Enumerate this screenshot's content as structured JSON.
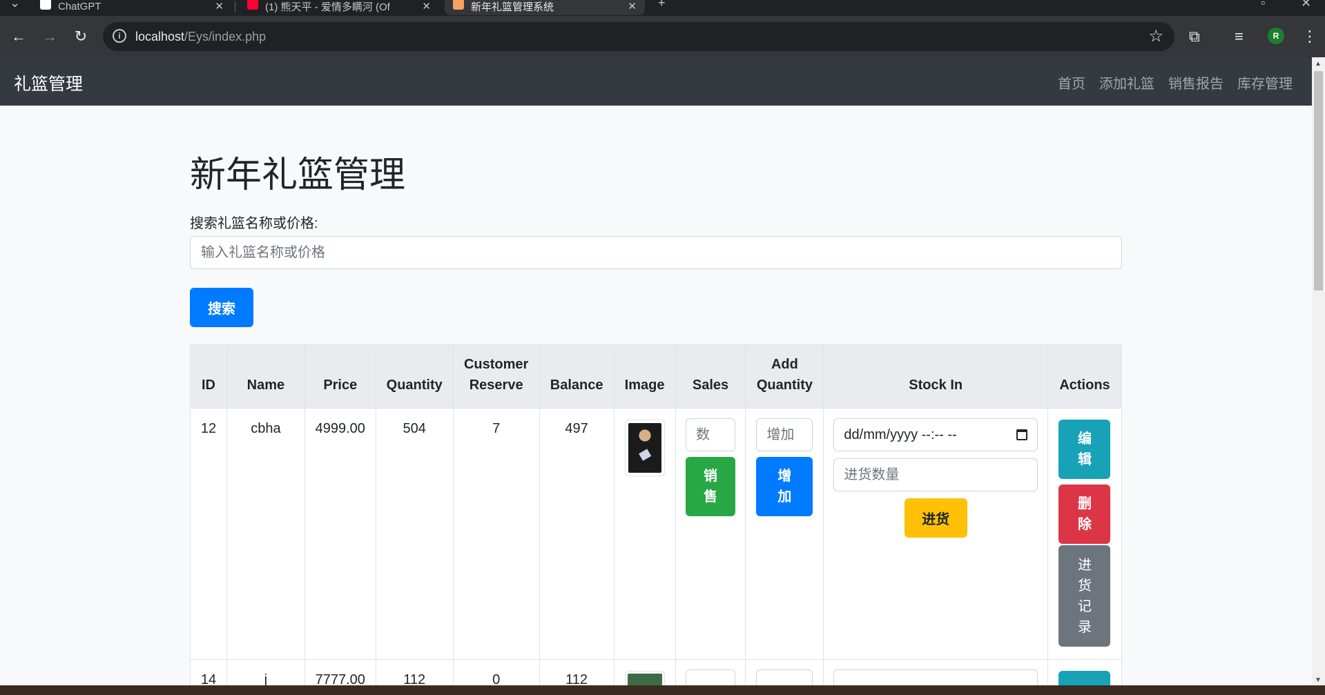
{
  "browser": {
    "tabs": [
      {
        "title": "ChatGPT",
        "favicon_color": "#ffffff"
      },
      {
        "title": "(1) 熊天平 - 爱情多瞒河 (Of",
        "favicon_color": "#ff0033"
      },
      {
        "title": "新年礼篮管理系统",
        "favicon_color": "#f4a261",
        "active": true
      }
    ],
    "new_tab": "+",
    "close_glyph": "✕",
    "url_host": "localhost",
    "url_path": "/Eys/index.php",
    "profile_initial": "R"
  },
  "navbar": {
    "brand": "礼篮管理",
    "links": [
      "首页",
      "添加礼篮",
      "销售报告",
      "库存管理"
    ]
  },
  "main": {
    "title": "新年礼篮管理",
    "search_label": "搜索礼篮名称或价格:",
    "search_placeholder": "输入礼篮名称或价格",
    "search_button": "搜索"
  },
  "table": {
    "headers": {
      "id": "ID",
      "name": "Name",
      "price": "Price",
      "quantity": "Quantity",
      "customer_reserve_1": "Customer",
      "customer_reserve_2": "Reserve",
      "balance": "Balance",
      "image": "Image",
      "sales": "Sales",
      "add_quantity_1": "Add",
      "add_quantity_2": "Quantity",
      "stock_in": "Stock In",
      "actions": "Actions"
    },
    "rows": [
      {
        "id": "12",
        "name": "cbha",
        "price": "4999.00",
        "quantity": "504",
        "customer_reserve": "7",
        "balance": "497",
        "sales_placeholder": "数",
        "sell_btn_1": "销",
        "sell_btn_2": "售",
        "add_placeholder": "增加",
        "add_btn_1": "增",
        "add_btn_2": "加",
        "date_placeholder": "dd/mm/yyyy --:-- --",
        "stock_qty_placeholder": "进货数量",
        "stock_btn": "进货",
        "edit_1": "编",
        "edit_2": "辑",
        "delete_1": "删",
        "delete_2": "除",
        "log_1": "进",
        "log_2": "货",
        "log_3": "记",
        "log_4": "录"
      },
      {
        "id": "14",
        "name": "j",
        "price": "7777.00",
        "quantity": "112",
        "customer_reserve": "0",
        "balance": "112"
      }
    ]
  },
  "colors": {
    "primary": "#007bff",
    "success": "#28a745",
    "warning": "#ffc107",
    "info": "#17a2b8",
    "danger": "#dc3545",
    "secondary": "#6c757d",
    "navbar": "#343a40"
  }
}
